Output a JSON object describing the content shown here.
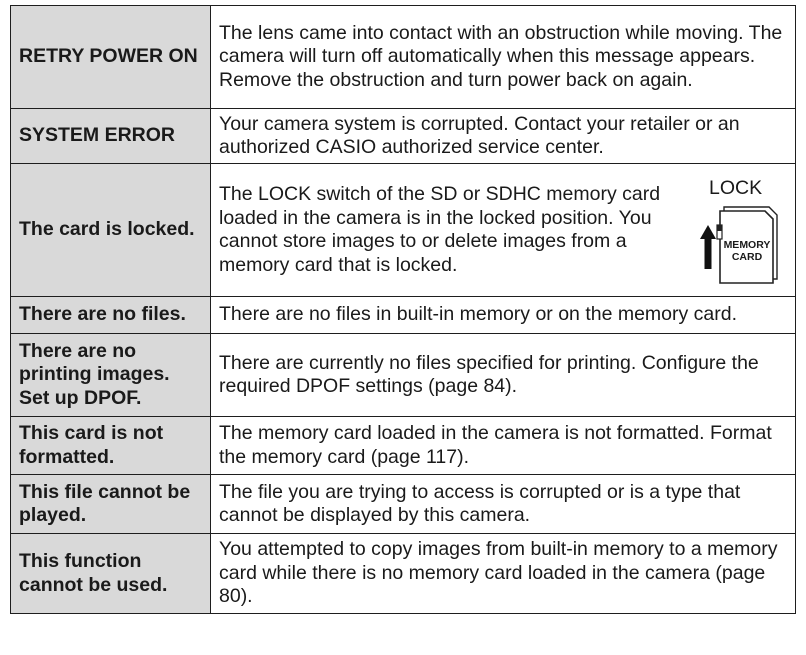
{
  "rows": [
    {
      "message": "RETRY POWER ON",
      "description": "The lens came into contact with an obstruction while moving. The camera will turn off automatically when this message appears. Remove the obstruction and turn power back on again."
    },
    {
      "message": "SYSTEM ERROR",
      "description": "Your camera system is corrupted. Contact your retailer or an authorized CASIO authorized service center."
    },
    {
      "message": "The card is locked.",
      "description": "The LOCK switch of the SD or SDHC memory card loaded in the camera is in the locked position. You cannot store images to or delete images from a memory card that is locked."
    },
    {
      "message": "There are no files.",
      "description": "There are no files in built-in memory or on the memory card."
    },
    {
      "message": "There are no printing images. Set up DPOF.",
      "description": "There are currently no files specified for printing. Configure the required DPOF settings (page 84)."
    },
    {
      "message": "This card is not formatted.",
      "description": "The memory card loaded in the camera is not formatted. Format the memory card (page 117)."
    },
    {
      "message": "This file cannot be played.",
      "description": "The file you are trying to access is corrupted or is a type that cannot be displayed by this camera."
    },
    {
      "message": "This function cannot be used.",
      "description": "You attempted to copy images from built-in memory to a memory card while there is no memory card loaded in the camera (page 80)."
    }
  ],
  "lock_figure": {
    "label": "LOCK",
    "card_label_line1": "MEMORY",
    "card_label_line2": "CARD"
  }
}
